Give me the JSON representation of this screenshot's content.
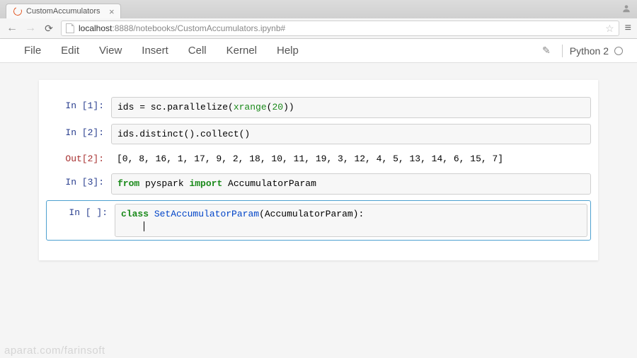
{
  "browser": {
    "tab_title": "CustomAccumulators",
    "url_host": "localhost",
    "url_port": ":8888",
    "url_path": "/notebooks/CustomAccumulators.ipynb#"
  },
  "menubar": {
    "items": [
      "File",
      "Edit",
      "View",
      "Insert",
      "Cell",
      "Kernel",
      "Help"
    ],
    "kernel_name": "Python 2"
  },
  "cells": [
    {
      "prompt_in": "In [1]:",
      "code_tokens": [
        {
          "t": "ids = sc.parallelize(",
          "c": ""
        },
        {
          "t": "xrange",
          "c": "cm-builtin"
        },
        {
          "t": "(",
          "c": ""
        },
        {
          "t": "20",
          "c": "cm-number"
        },
        {
          "t": "))",
          "c": ""
        }
      ]
    },
    {
      "prompt_in": "In [2]:",
      "code_tokens": [
        {
          "t": "ids.distinct().collect()",
          "c": ""
        }
      ],
      "prompt_out": "Out[2]:",
      "output": "[0, 8, 16, 1, 17, 9, 2, 18, 10, 11, 19, 3, 12, 4, 5, 13, 14, 6, 15, 7]"
    },
    {
      "prompt_in": "In [3]:",
      "code_tokens": [
        {
          "t": "from",
          "c": "cm-keyword"
        },
        {
          "t": " pyspark ",
          "c": ""
        },
        {
          "t": "import",
          "c": "cm-keyword"
        },
        {
          "t": " AccumulatorParam",
          "c": ""
        }
      ]
    },
    {
      "selected": true,
      "prompt_in": "In [ ]:",
      "code_tokens": [
        {
          "t": "class",
          "c": "cm-keyword"
        },
        {
          "t": " ",
          "c": ""
        },
        {
          "t": "SetAccumulatorParam",
          "c": "cm-def"
        },
        {
          "t": "(AccumulatorParam):",
          "c": ""
        }
      ],
      "second_line_indent": "    "
    }
  ],
  "watermark": "aparat.com/farinsoft"
}
